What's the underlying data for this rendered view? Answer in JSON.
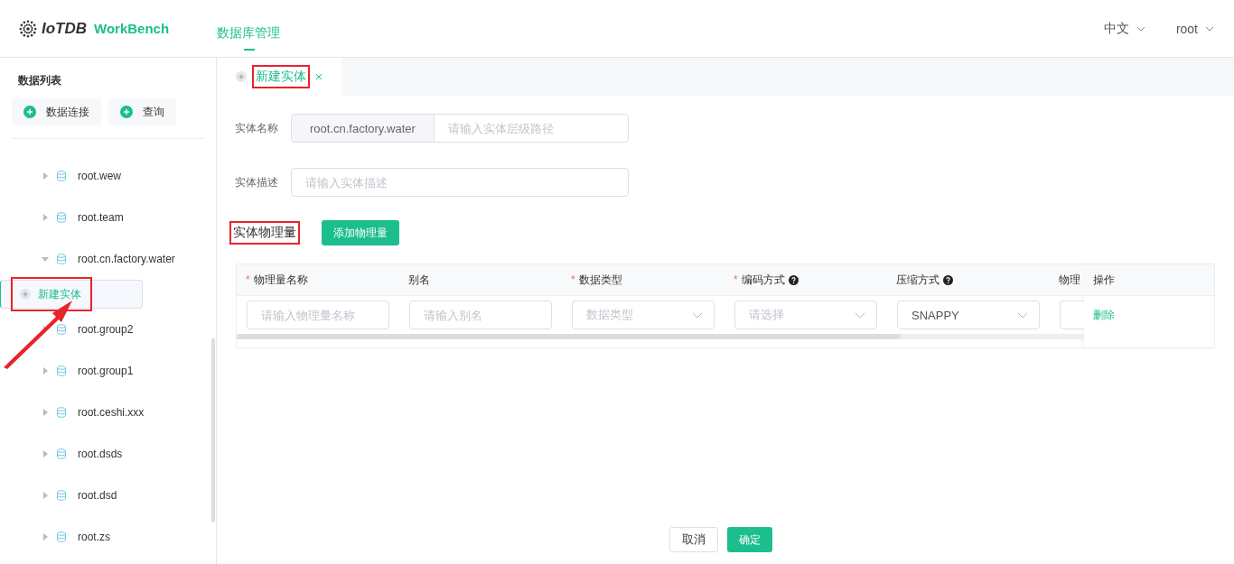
{
  "header": {
    "brand": "IoTDB",
    "product": "WorkBench",
    "nav": [
      {
        "label": "数据库管理",
        "selected": true
      }
    ],
    "language": "中文",
    "user": "root"
  },
  "sidebar": {
    "title": "数据列表",
    "actions": [
      "数据连接",
      "查询"
    ],
    "tree": [
      {
        "label": "root.wew",
        "expanded": false
      },
      {
        "label": "root.team",
        "expanded": false
      },
      {
        "label": "root.cn.factory.water",
        "expanded": true,
        "children": [
          {
            "label": "新建实体",
            "selected": true,
            "highlighted": true
          }
        ]
      },
      {
        "label": "root.group2",
        "expanded": false
      },
      {
        "label": "root.group1",
        "expanded": false
      },
      {
        "label": "root.ceshi.xxx",
        "expanded": false
      },
      {
        "label": "root.dsds",
        "expanded": false
      },
      {
        "label": "root.dsd",
        "expanded": false
      },
      {
        "label": "root.zs",
        "expanded": false
      }
    ]
  },
  "tabs": [
    {
      "label": "新建实体",
      "selected": true,
      "highlighted": true
    }
  ],
  "form": {
    "name_label": "实体名称",
    "name_prefix": "root.cn.factory.water",
    "name_placeholder": "请输入实体层级路径",
    "desc_label": "实体描述",
    "desc_placeholder": "请输入实体描述"
  },
  "section": {
    "title": "实体物理量",
    "highlighted": true,
    "add_button": "添加物理量"
  },
  "table": {
    "columns": [
      {
        "label": "物理量名称",
        "required_mark": "*",
        "help": false
      },
      {
        "label": "别名",
        "help": false
      },
      {
        "label": "数据类型",
        "required_mark": "*",
        "help": false
      },
      {
        "label": "编码方式",
        "required_mark": "*",
        "help": true
      },
      {
        "label": "压缩方式",
        "help": true
      },
      {
        "label": "物理"
      }
    ],
    "fixed_column": "操作",
    "rows": [
      {
        "cells": [
          {
            "kind": "input",
            "placeholder": "请输入物理量名称"
          },
          {
            "kind": "input",
            "placeholder": "请输入别名"
          },
          {
            "kind": "select",
            "placeholder": "数据类型"
          },
          {
            "kind": "select",
            "placeholder": "请选择"
          },
          {
            "kind": "select",
            "value": "SNAPPY"
          },
          {
            "kind": "input"
          }
        ],
        "action": "删除"
      }
    ]
  },
  "footer": {
    "cancel": "取消",
    "confirm": "确定"
  }
}
